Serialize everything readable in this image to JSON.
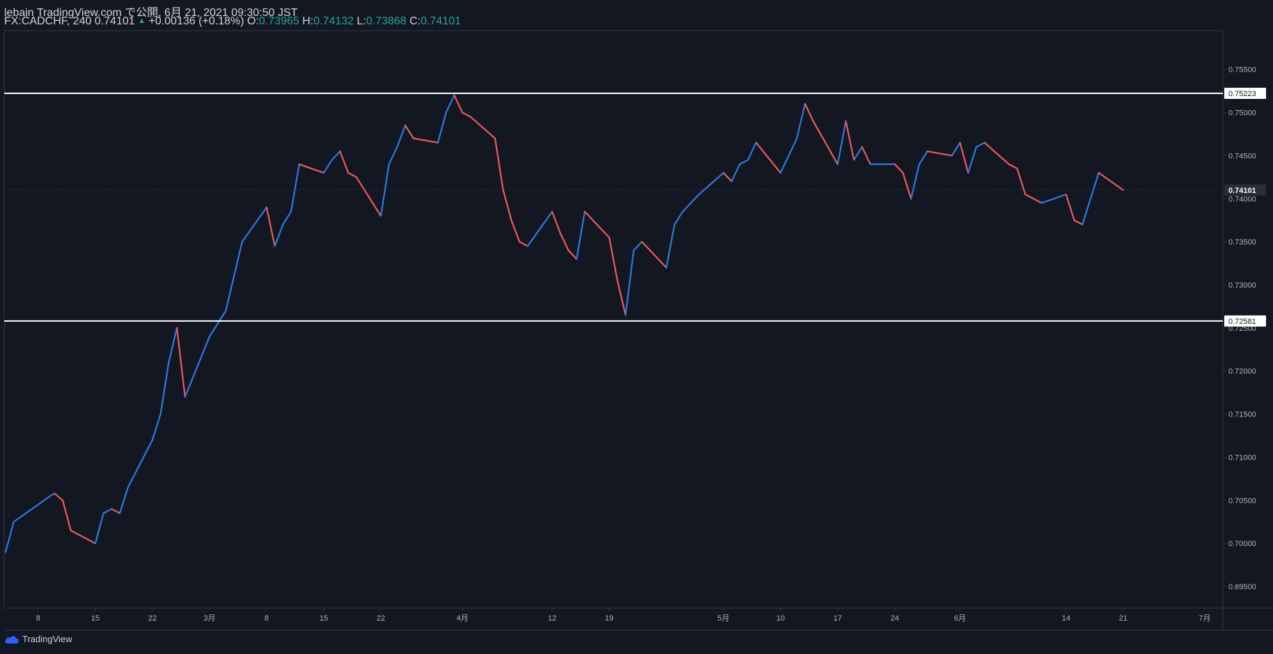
{
  "header": {
    "line1": "lebain TradingView.com で公開, 6月 21, 2021 09:30:50 JST",
    "symbol_info": "FX:CADCHF, 240 0.74101",
    "change_arrow": "▲",
    "change": "+0.00136 (+0.18%)",
    "o_label": "O:",
    "o_value": "0.73965",
    "h_label": "H:",
    "h_value": "0.74132",
    "l_label": "L:",
    "l_value": "0.73868",
    "c_label": "C:",
    "c_value": "0.74101"
  },
  "footer": {
    "brand": "TradingView"
  },
  "colors": {
    "background": "#131722",
    "bull": "#2b7be4",
    "bear": "#f05a5a",
    "line": "#ffffff",
    "axis_text": "#b2b5be",
    "border": "#363a45"
  },
  "chart_data": {
    "type": "line",
    "symbol": "FX:CADCHF",
    "timeframe": "240",
    "ylim": [
      0.6925,
      0.7595
    ],
    "y_ticks": [
      0.755,
      0.75,
      0.745,
      0.74,
      0.735,
      0.73,
      0.725,
      0.72,
      0.715,
      0.71,
      0.705,
      0.7,
      0.695
    ],
    "y_tick_labels": [
      "0.75500",
      "0.75000",
      "0.74500",
      "0.74000",
      "0.73500",
      "0.73000",
      "0.72500",
      "0.72000",
      "0.71500",
      "0.71000",
      "0.70500",
      "0.70000",
      "0.69500"
    ],
    "x_ticks": [
      {
        "label": "8",
        "date": "2021-02-08"
      },
      {
        "label": "15",
        "date": "2021-02-15"
      },
      {
        "label": "22",
        "date": "2021-02-22"
      },
      {
        "label": "3月",
        "date": "2021-03-01"
      },
      {
        "label": "8",
        "date": "2021-03-08"
      },
      {
        "label": "15",
        "date": "2021-03-15"
      },
      {
        "label": "22",
        "date": "2021-03-22"
      },
      {
        "label": "4月",
        "date": "2021-04-01"
      },
      {
        "label": "12",
        "date": "2021-04-12"
      },
      {
        "label": "19",
        "date": "2021-04-19"
      },
      {
        "label": "5月",
        "date": "2021-05-03"
      },
      {
        "label": "10",
        "date": "2021-05-10"
      },
      {
        "label": "17",
        "date": "2021-05-17"
      },
      {
        "label": "24",
        "date": "2021-05-24"
      },
      {
        "label": "6月",
        "date": "2021-06-01"
      },
      {
        "label": "14",
        "date": "2021-06-14"
      },
      {
        "label": "21",
        "date": "2021-06-21"
      },
      {
        "label": "7月",
        "date": "2021-07-01"
      }
    ],
    "horizontal_lines": [
      {
        "value": 0.75223,
        "label": "0.75223"
      },
      {
        "value": 0.72581,
        "label": "0.72581"
      }
    ],
    "last_price": {
      "value": 0.74101,
      "label": "0.74101"
    },
    "series": [
      {
        "values": [
          {
            "date": "2021-02-04",
            "close": 0.699
          },
          {
            "date": "2021-02-05",
            "close": 0.7025
          },
          {
            "date": "2021-02-08",
            "close": 0.7045
          },
          {
            "date": "2021-02-09",
            "close": 0.7052
          },
          {
            "date": "2021-02-10",
            "close": 0.7058
          },
          {
            "date": "2021-02-11",
            "close": 0.705
          },
          {
            "date": "2021-02-12",
            "close": 0.7015
          },
          {
            "date": "2021-02-15",
            "close": 0.7
          },
          {
            "date": "2021-02-16",
            "close": 0.7035
          },
          {
            "date": "2021-02-17",
            "close": 0.704
          },
          {
            "date": "2021-02-18",
            "close": 0.7035
          },
          {
            "date": "2021-02-19",
            "close": 0.7065
          },
          {
            "date": "2021-02-22",
            "close": 0.712
          },
          {
            "date": "2021-02-23",
            "close": 0.715
          },
          {
            "date": "2021-02-24",
            "close": 0.721
          },
          {
            "date": "2021-02-25",
            "close": 0.725
          },
          {
            "date": "2021-02-26",
            "close": 0.717
          },
          {
            "date": "2021-03-01",
            "close": 0.724
          },
          {
            "date": "2021-03-02",
            "close": 0.7255
          },
          {
            "date": "2021-03-03",
            "close": 0.727
          },
          {
            "date": "2021-03-04",
            "close": 0.731
          },
          {
            "date": "2021-03-05",
            "close": 0.735
          },
          {
            "date": "2021-03-08",
            "close": 0.739
          },
          {
            "date": "2021-03-09",
            "close": 0.7345
          },
          {
            "date": "2021-03-10",
            "close": 0.737
          },
          {
            "date": "2021-03-11",
            "close": 0.7385
          },
          {
            "date": "2021-03-12",
            "close": 0.744
          },
          {
            "date": "2021-03-15",
            "close": 0.743
          },
          {
            "date": "2021-03-16",
            "close": 0.7445
          },
          {
            "date": "2021-03-17",
            "close": 0.7455
          },
          {
            "date": "2021-03-18",
            "close": 0.743
          },
          {
            "date": "2021-03-19",
            "close": 0.7425
          },
          {
            "date": "2021-03-22",
            "close": 0.738
          },
          {
            "date": "2021-03-23",
            "close": 0.744
          },
          {
            "date": "2021-03-24",
            "close": 0.746
          },
          {
            "date": "2021-03-25",
            "close": 0.7485
          },
          {
            "date": "2021-03-26",
            "close": 0.747
          },
          {
            "date": "2021-03-29",
            "close": 0.7465
          },
          {
            "date": "2021-03-30",
            "close": 0.75
          },
          {
            "date": "2021-03-31",
            "close": 0.752
          },
          {
            "date": "2021-04-01",
            "close": 0.75
          },
          {
            "date": "2021-04-02",
            "close": 0.7495
          },
          {
            "date": "2021-04-05",
            "close": 0.747
          },
          {
            "date": "2021-04-06",
            "close": 0.741
          },
          {
            "date": "2021-04-07",
            "close": 0.7375
          },
          {
            "date": "2021-04-08",
            "close": 0.735
          },
          {
            "date": "2021-04-09",
            "close": 0.7345
          },
          {
            "date": "2021-04-12",
            "close": 0.7385
          },
          {
            "date": "2021-04-13",
            "close": 0.736
          },
          {
            "date": "2021-04-14",
            "close": 0.734
          },
          {
            "date": "2021-04-15",
            "close": 0.733
          },
          {
            "date": "2021-04-16",
            "close": 0.7385
          },
          {
            "date": "2021-04-19",
            "close": 0.7355
          },
          {
            "date": "2021-04-20",
            "close": 0.7305
          },
          {
            "date": "2021-04-21",
            "close": 0.7265
          },
          {
            "date": "2021-04-22",
            "close": 0.734
          },
          {
            "date": "2021-04-23",
            "close": 0.735
          },
          {
            "date": "2021-04-26",
            "close": 0.732
          },
          {
            "date": "2021-04-27",
            "close": 0.737
          },
          {
            "date": "2021-04-28",
            "close": 0.7385
          },
          {
            "date": "2021-04-29",
            "close": 0.7395
          },
          {
            "date": "2021-04-30",
            "close": 0.7405
          },
          {
            "date": "2021-05-03",
            "close": 0.743
          },
          {
            "date": "2021-05-04",
            "close": 0.742
          },
          {
            "date": "2021-05-05",
            "close": 0.744
          },
          {
            "date": "2021-05-06",
            "close": 0.7445
          },
          {
            "date": "2021-05-07",
            "close": 0.7465
          },
          {
            "date": "2021-05-10",
            "close": 0.743
          },
          {
            "date": "2021-05-11",
            "close": 0.745
          },
          {
            "date": "2021-05-12",
            "close": 0.747
          },
          {
            "date": "2021-05-13",
            "close": 0.751
          },
          {
            "date": "2021-05-14",
            "close": 0.749
          },
          {
            "date": "2021-05-17",
            "close": 0.744
          },
          {
            "date": "2021-05-18",
            "close": 0.749
          },
          {
            "date": "2021-05-19",
            "close": 0.7445
          },
          {
            "date": "2021-05-20",
            "close": 0.746
          },
          {
            "date": "2021-05-21",
            "close": 0.744
          },
          {
            "date": "2021-05-24",
            "close": 0.744
          },
          {
            "date": "2021-05-25",
            "close": 0.743
          },
          {
            "date": "2021-05-26",
            "close": 0.74
          },
          {
            "date": "2021-05-27",
            "close": 0.744
          },
          {
            "date": "2021-05-28",
            "close": 0.7455
          },
          {
            "date": "2021-05-31",
            "close": 0.745
          },
          {
            "date": "2021-06-01",
            "close": 0.7465
          },
          {
            "date": "2021-06-02",
            "close": 0.743
          },
          {
            "date": "2021-06-03",
            "close": 0.746
          },
          {
            "date": "2021-06-04",
            "close": 0.7465
          },
          {
            "date": "2021-06-07",
            "close": 0.744
          },
          {
            "date": "2021-06-08",
            "close": 0.7435
          },
          {
            "date": "2021-06-09",
            "close": 0.7405
          },
          {
            "date": "2021-06-10",
            "close": 0.74
          },
          {
            "date": "2021-06-11",
            "close": 0.7395
          },
          {
            "date": "2021-06-14",
            "close": 0.7405
          },
          {
            "date": "2021-06-15",
            "close": 0.7375
          },
          {
            "date": "2021-06-16",
            "close": 0.737
          },
          {
            "date": "2021-06-17",
            "close": 0.74
          },
          {
            "date": "2021-06-18",
            "close": 0.743
          },
          {
            "date": "2021-06-21",
            "close": 0.741
          }
        ]
      }
    ]
  }
}
